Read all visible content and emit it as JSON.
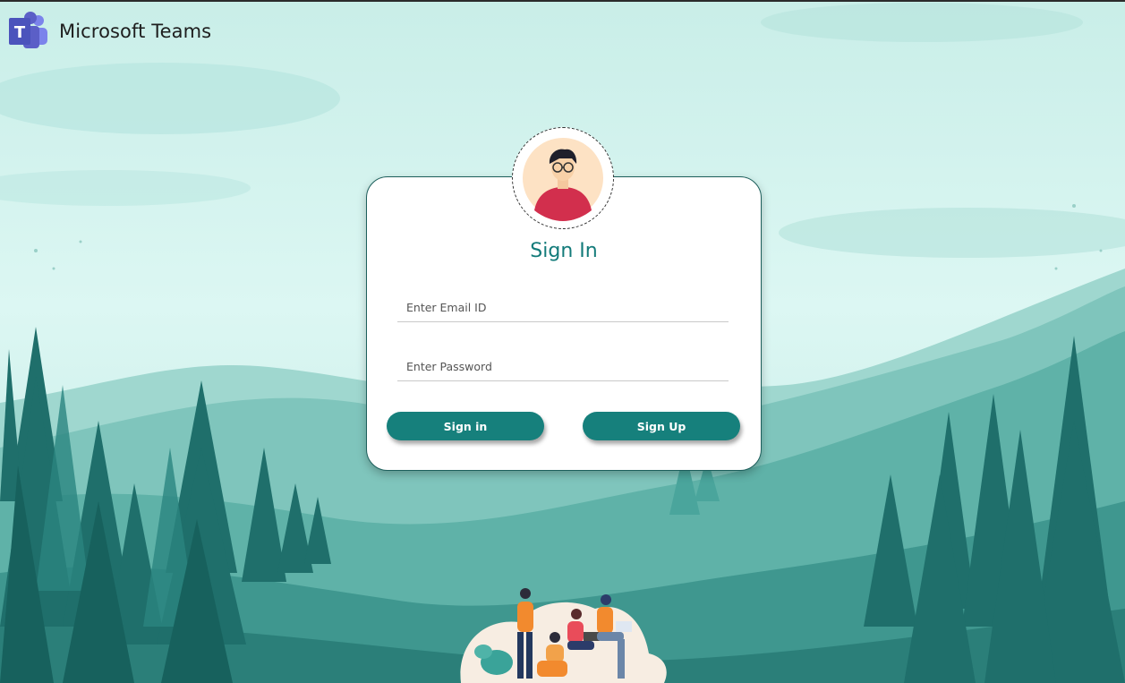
{
  "brand": {
    "name": "Microsoft Teams",
    "logo_icon": "teams-logo-icon",
    "logo_color": "#5b5fc7"
  },
  "login": {
    "title": "Sign In",
    "email_placeholder": "Enter Email ID",
    "email_value": "",
    "password_placeholder": "Enter Password",
    "password_value": "",
    "signin_label": "Sign in",
    "signup_label": "Sign Up",
    "avatar_icon": "user-avatar-icon"
  },
  "colors": {
    "accent": "#16807c",
    "title": "#137b7a",
    "sky": "#d9f5f0",
    "mountain": "#5fb7ae",
    "forest": "#1d6f6c"
  }
}
